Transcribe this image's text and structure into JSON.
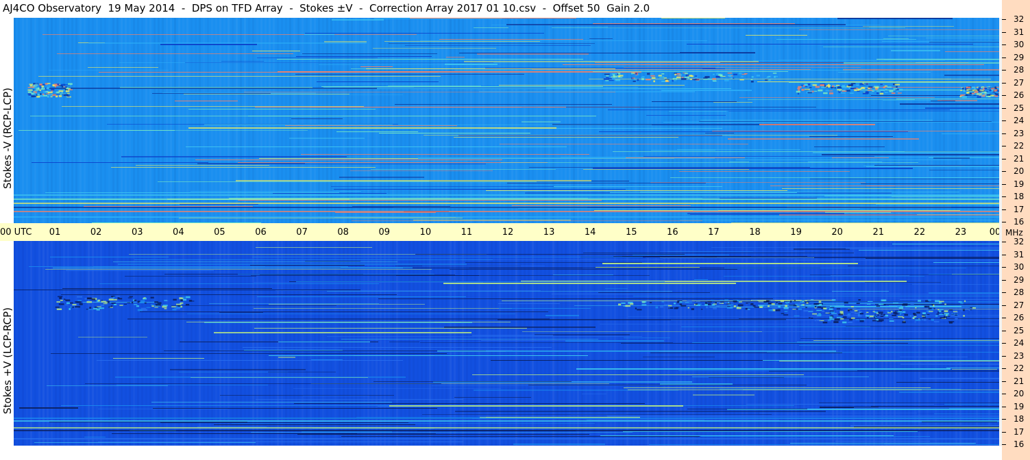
{
  "title": "AJ4CO Observatory  19 May 2014  -  DPS on TFD Array  -  Stokes ±V  -  Correction Array 2017 01 10.csv  -  Offset 50  Gain 2.0",
  "panels": [
    {
      "name": "top",
      "ylabel": "Stokes -V (RCP-LCP)"
    },
    {
      "name": "bottom",
      "ylabel": "Stokes +V (LCP-RCP)"
    }
  ],
  "colors": {
    "top_base": "#1a8ff0",
    "bottom_base": "#1250e0",
    "utc_band": "#ffffc8",
    "mhz_axis": "#ffdcc0"
  },
  "chart_data": {
    "type": "heatmap",
    "x_axis": {
      "unit": "UTC",
      "ticks": [
        "00 UTC",
        "01",
        "02",
        "03",
        "04",
        "05",
        "06",
        "07",
        "08",
        "09",
        "10",
        "11",
        "12",
        "13",
        "14",
        "15",
        "16",
        "17",
        "18",
        "19",
        "20",
        "21",
        "22",
        "23",
        "00"
      ],
      "range": [
        0,
        24
      ]
    },
    "y_axis": {
      "unit": "MHz",
      "ticks": [
        "32",
        "31",
        "30",
        "29",
        "28",
        "27",
        "26",
        "25",
        "24",
        "23",
        "22",
        "21",
        "20",
        "19",
        "18",
        "17",
        "16"
      ],
      "range": [
        16,
        32
      ]
    },
    "series": [
      {
        "name": "Stokes -V (RCP-LCP)"
      },
      {
        "name": "Stokes +V (LCP-RCP)"
      }
    ]
  }
}
